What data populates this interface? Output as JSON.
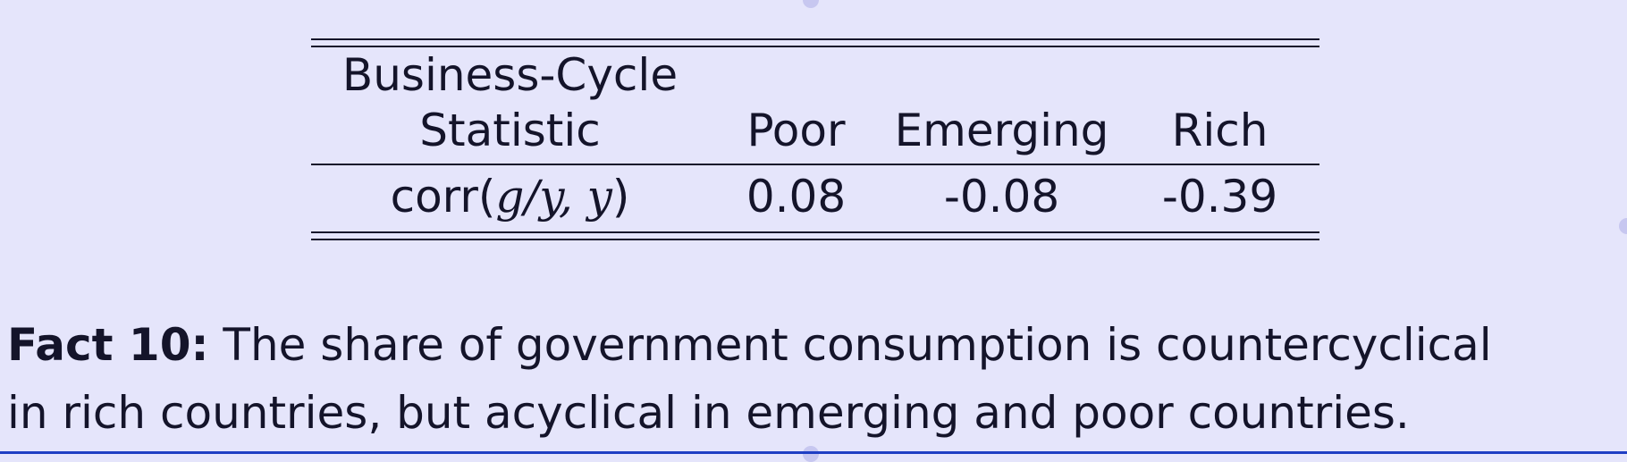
{
  "table": {
    "headers": {
      "statistic_line1": "Business-Cycle",
      "statistic_line2": "Statistic",
      "poor": "Poor",
      "emerging": "Emerging",
      "rich": "Rich"
    },
    "row": {
      "stat_prefix": "corr(",
      "stat_math": "g/y, y",
      "stat_suffix": ")",
      "poor": "0.08",
      "emerging": "-0.08",
      "rich": "-0.39"
    }
  },
  "caption": {
    "label": "Fact 10:",
    "line1": "The share of government consumption is countercyclical",
    "line2": "in rich countries, but acyclical in emerging and poor countries."
  }
}
